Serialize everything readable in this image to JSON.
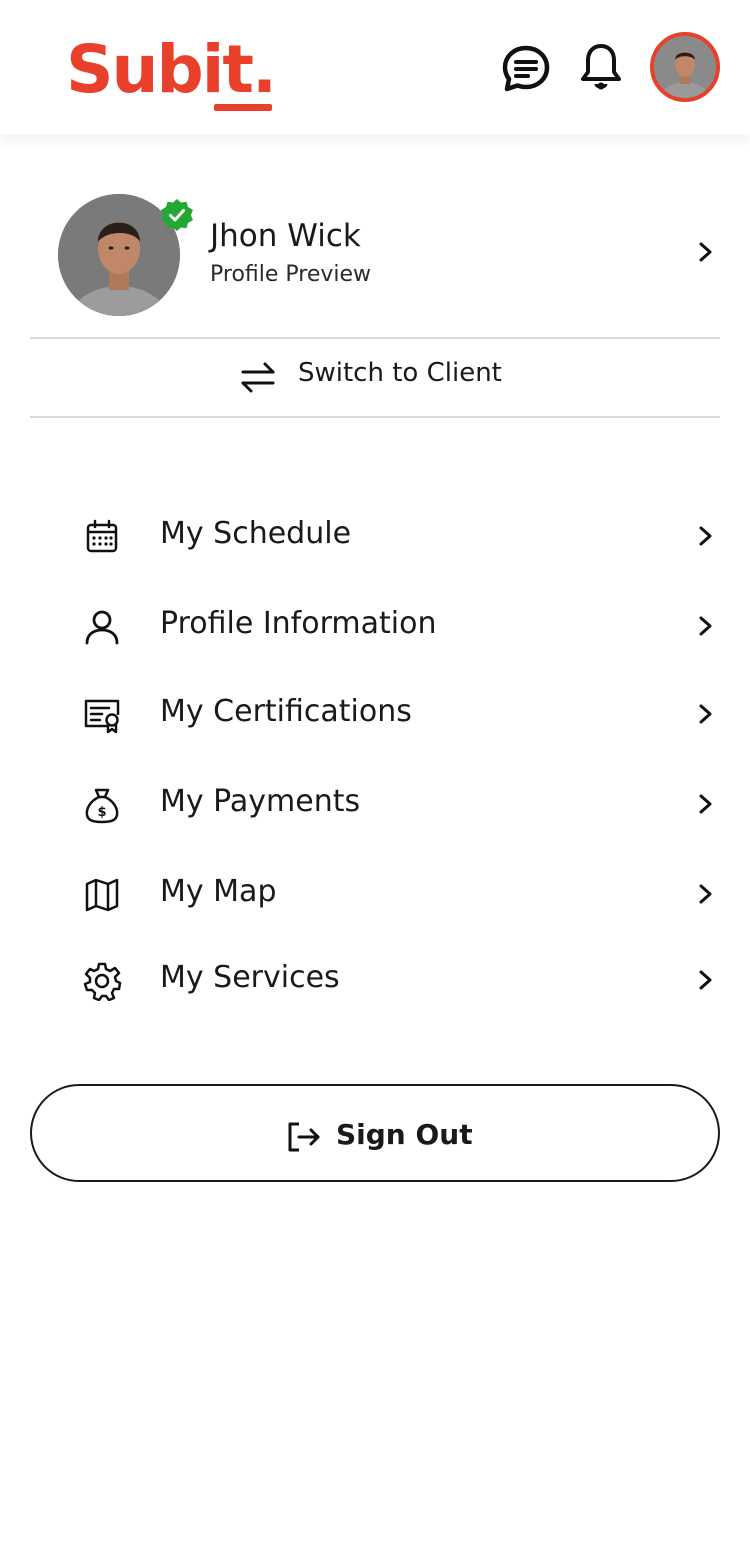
{
  "app": {
    "logo_text_main": "Sub",
    "logo_text_accent": "it.",
    "brand_color": "#e8402a"
  },
  "header": {
    "chat_icon": "chat-bubble-icon",
    "notification_icon": "bell-icon"
  },
  "profile": {
    "name": "Jhon Wick",
    "subtitle": "Profile Preview",
    "verified": true,
    "verified_color": "#22a833"
  },
  "switch_role": {
    "label": "Switch to Client",
    "icon": "swap-arrows-icon"
  },
  "menu": {
    "items": [
      {
        "label": "My Schedule",
        "icon": "calendar-icon"
      },
      {
        "label": "Profile Information",
        "icon": "user-icon"
      },
      {
        "label": "My Certifications",
        "icon": "certificate-icon"
      },
      {
        "label": "My Payments",
        "icon": "money-bag-icon"
      },
      {
        "label": "My Map",
        "icon": "map-icon"
      },
      {
        "label": "My Services",
        "icon": "gear-icon"
      }
    ]
  },
  "sign_out": {
    "label": "Sign Out",
    "icon": "sign-out-icon"
  }
}
